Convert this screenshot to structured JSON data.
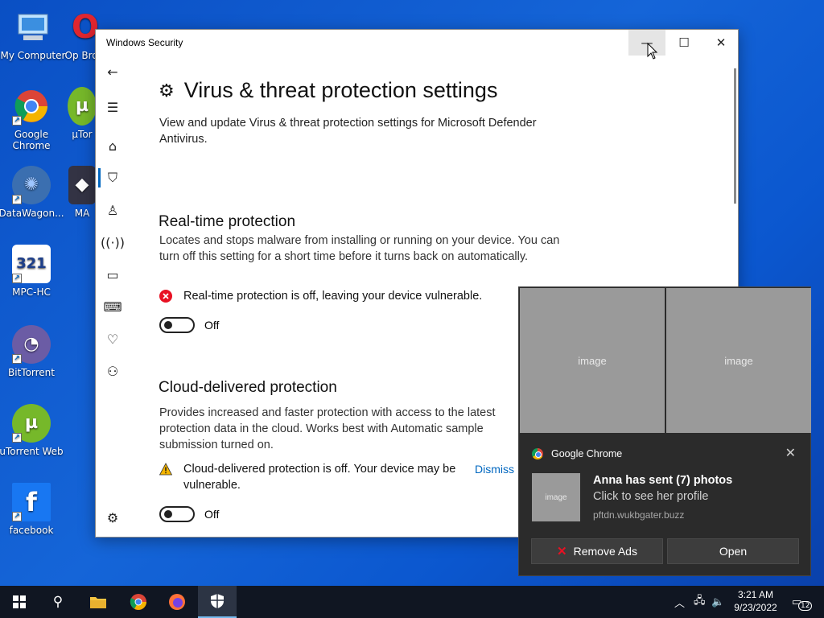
{
  "desktop": {
    "icons": [
      {
        "label": "My Computer",
        "icon": "computer-icon"
      },
      {
        "label": "Google Chrome",
        "icon": "chrome-icon"
      },
      {
        "label": "DataWagon...",
        "icon": "datawagon-icon"
      },
      {
        "label": "MPC-HC",
        "icon": "mpc-hc-icon"
      },
      {
        "label": "BitTorrent",
        "icon": "bittorrent-icon"
      },
      {
        "label": "uTorrent Web",
        "icon": "utorrent-icon"
      },
      {
        "label": "facebook",
        "icon": "facebook-icon"
      },
      {
        "label": "Op Brow",
        "icon": "opera-icon"
      },
      {
        "label": "µTor",
        "icon": "utorrent-icon"
      },
      {
        "label": "MA",
        "icon": "app-icon"
      }
    ]
  },
  "window": {
    "title": "Windows Security",
    "nav": [
      "back-arrow-icon",
      "hamburger-menu-icon",
      "home-icon",
      "shield-icon",
      "person-icon",
      "wireless-icon",
      "browser-window-icon",
      "laptop-icon",
      "heart-icon",
      "family-icon",
      "settings-gear-icon"
    ],
    "page_title": "Virus & threat protection settings",
    "page_desc": "View and update Virus & threat protection settings for Microsoft Defender Antivirus.",
    "sections": [
      {
        "title": "Real-time protection",
        "desc": "Locates and stops malware from installing or running on your device. You can turn off this setting for a short time before it turns back on automatically.",
        "status": "Real-time protection is off, leaving your device vulnerable.",
        "status_icon": "error-x-icon",
        "toggle_label": "Off"
      },
      {
        "title": "Cloud-delivered protection",
        "desc": "Provides increased and faster protection with access to the latest protection data in the cloud. Works best with Automatic sample submission turned on.",
        "status": "Cloud-delivered protection is off. Your device may be vulnerable.",
        "status_icon": "warning-triangle-icon",
        "dismiss": "Dismiss",
        "toggle_label": "Off"
      }
    ]
  },
  "notification": {
    "app": "Google Chrome",
    "image_placeholder": "image",
    "title": "Anna has sent (7) photos",
    "body": "Click to see her profile",
    "source": "pftdn.wukbgater.buzz",
    "buttons": {
      "remove": "Remove Ads",
      "open": "Open"
    }
  },
  "taskbar": {
    "clock_time": "3:21 AM",
    "clock_date": "9/23/2022",
    "notification_count": "12"
  },
  "colors": {
    "accent": "#0067c0",
    "error": "#e81123",
    "warning": "#f4b400"
  }
}
